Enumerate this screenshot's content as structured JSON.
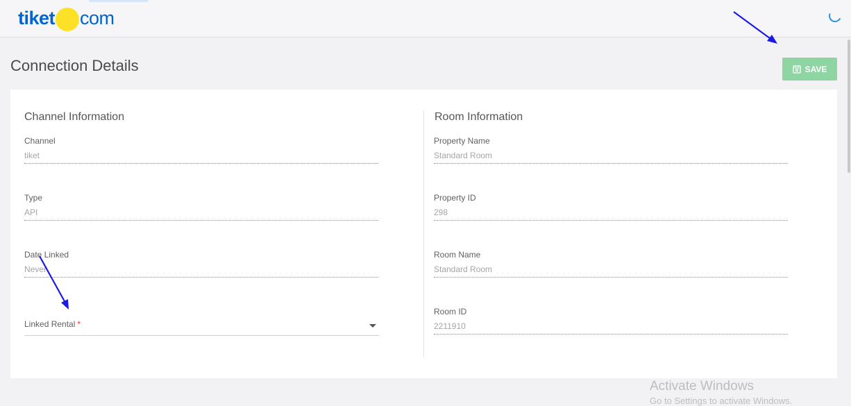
{
  "header": {
    "logo_left": "tiket",
    "logo_right": "com"
  },
  "page": {
    "title": "Connection Details",
    "save_label": "SAVE"
  },
  "channel_section": {
    "title": "Channel Information",
    "fields": [
      {
        "label": "Channel",
        "value": "tiket"
      },
      {
        "label": "Type",
        "value": "API"
      },
      {
        "label": "Date Linked",
        "value": "Never"
      }
    ],
    "linked_rental": {
      "label": "Linked Rental",
      "required_mark": "*",
      "value": ""
    }
  },
  "room_section": {
    "title": "Room Information",
    "fields": [
      {
        "label": "Property Name",
        "value": "Standard Room"
      },
      {
        "label": "Property ID",
        "value": "298"
      },
      {
        "label": "Room Name",
        "value": "Standard Room"
      },
      {
        "label": "Room ID",
        "value": "2211910"
      }
    ]
  },
  "watermark": {
    "line1": "Activate Windows",
    "line2": "Go to Settings to activate Windows."
  },
  "colors": {
    "brand_blue": "#0064d2",
    "brand_yellow": "#fde126",
    "save_button": "#8fd4a3",
    "annotation_arrow": "#1a1ae6",
    "required": "#e53935"
  },
  "icons": {
    "save": "floppy-disk-icon",
    "spinner": "loading-spinner-icon",
    "caret": "dropdown-caret-icon"
  }
}
